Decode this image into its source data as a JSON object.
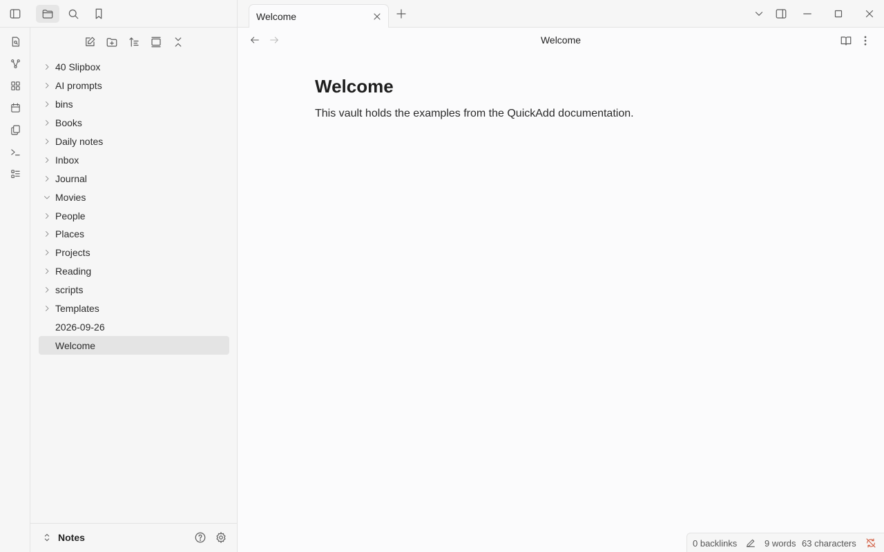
{
  "top_left": {
    "toggle_icon": "sidebar-left-icon",
    "tabs": [
      {
        "icon": "folder-icon",
        "active": true
      },
      {
        "icon": "search-icon",
        "active": false
      },
      {
        "icon": "bookmark-icon",
        "active": false
      }
    ]
  },
  "ribbon": {
    "items": [
      "quick-switcher-icon",
      "graph-icon",
      "canvas-icon",
      "calendar-icon",
      "templates-icon",
      "command-palette-icon",
      "list-icon"
    ]
  },
  "sidebar": {
    "nav_actions": [
      "new-note-icon",
      "new-folder-icon",
      "sort-icon",
      "auto-reveal-icon",
      "collapse-all-icon"
    ],
    "items": [
      {
        "label": "40 Slipbox",
        "type": "folder",
        "expanded": false
      },
      {
        "label": "AI prompts",
        "type": "folder",
        "expanded": false
      },
      {
        "label": "bins",
        "type": "folder",
        "expanded": false
      },
      {
        "label": "Books",
        "type": "folder",
        "expanded": false
      },
      {
        "label": "Daily notes",
        "type": "folder",
        "expanded": false
      },
      {
        "label": "Inbox",
        "type": "folder",
        "expanded": false
      },
      {
        "label": "Journal",
        "type": "folder",
        "expanded": false
      },
      {
        "label": "Movies",
        "type": "folder",
        "expanded": true
      },
      {
        "label": "People",
        "type": "folder",
        "expanded": false
      },
      {
        "label": "Places",
        "type": "folder",
        "expanded": false
      },
      {
        "label": "Projects",
        "type": "folder",
        "expanded": false
      },
      {
        "label": "Reading",
        "type": "folder",
        "expanded": false
      },
      {
        "label": "scripts",
        "type": "folder",
        "expanded": false
      },
      {
        "label": "Templates",
        "type": "folder",
        "expanded": false
      },
      {
        "label": "2026-09-26",
        "type": "file",
        "selected": false
      },
      {
        "label": "Welcome",
        "type": "file",
        "selected": true
      }
    ],
    "footer": {
      "vault_name": "Notes",
      "help_icon": "help-icon",
      "settings_icon": "gear-icon"
    }
  },
  "tabbar": {
    "tab_title": "Welcome",
    "window_controls": [
      "chevron-down-icon",
      "sidebar-right-icon",
      "minimize-icon",
      "maximize-icon",
      "close-icon"
    ]
  },
  "editor": {
    "view_title": "Welcome",
    "heading": "Welcome",
    "body": "This vault holds the examples from the QuickAdd documentation."
  },
  "status": {
    "backlinks": "0 backlinks",
    "words": "9 words",
    "characters": "63 characters",
    "sync_color": "#d0573a"
  },
  "colors": {
    "sidebar_bg": "#f6f6f6",
    "editor_bg": "#fbfbfc",
    "selected_bg": "#e4e4e4"
  }
}
